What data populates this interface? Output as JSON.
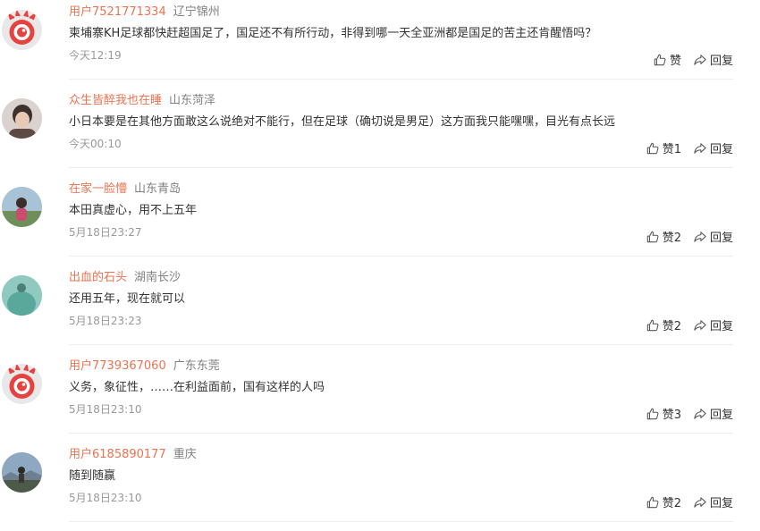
{
  "comments": [
    {
      "user": "用户7521771334",
      "location": "辽宁锦州",
      "text": "柬埔寨KH足球都快赶超国足了，国足还不有所行动，非得到哪一天全亚洲都是国足的苦主还肯醒悟吗？",
      "time": "今天12:19",
      "like_label": "赞",
      "reply_label": "回复",
      "avatar": "default-eye-avatar"
    },
    {
      "user": "众生皆醉我也在睡",
      "location": "山东菏泽",
      "text": "小日本要是在其他方面敢这么说绝对不能行，但在足球（确切说是男足）这方面我只能嘿嘿，目光有点长远",
      "time": "今天00:10",
      "like_label": "赞1",
      "reply_label": "回复",
      "avatar": "photo-avatar"
    },
    {
      "user": "在家一脸懵",
      "location": "山东青岛",
      "text": "本田真虚心，用不上五年",
      "time": "5月18日23:27",
      "like_label": "赞2",
      "reply_label": "回复",
      "avatar": "photo-avatar"
    },
    {
      "user": "出血的石头",
      "location": "湖南长沙",
      "text": "还用五年，现在就可以",
      "time": "5月18日23:23",
      "like_label": "赞2",
      "reply_label": "回复",
      "avatar": "photo-avatar"
    },
    {
      "user": "用户7739367060",
      "location": "广东东莞",
      "text": "义务，象征性，……在利益面前，国有这样的人吗",
      "time": "5月18日23:10",
      "like_label": "赞3",
      "reply_label": "回复",
      "avatar": "default-eye-avatar"
    },
    {
      "user": "用户6185890177",
      "location": "重庆",
      "text": "随到随赢",
      "time": "5月18日23:10",
      "like_label": "赞2",
      "reply_label": "回复",
      "avatar": "photo-avatar"
    }
  ],
  "colors": {
    "username": "#eb7350",
    "location": "#808080",
    "body_text": "#333333",
    "timestamp": "#999999",
    "divider": "#eeeeee"
  },
  "icons": {
    "like": "thumbs-up-icon",
    "reply": "share-arrow-icon"
  }
}
